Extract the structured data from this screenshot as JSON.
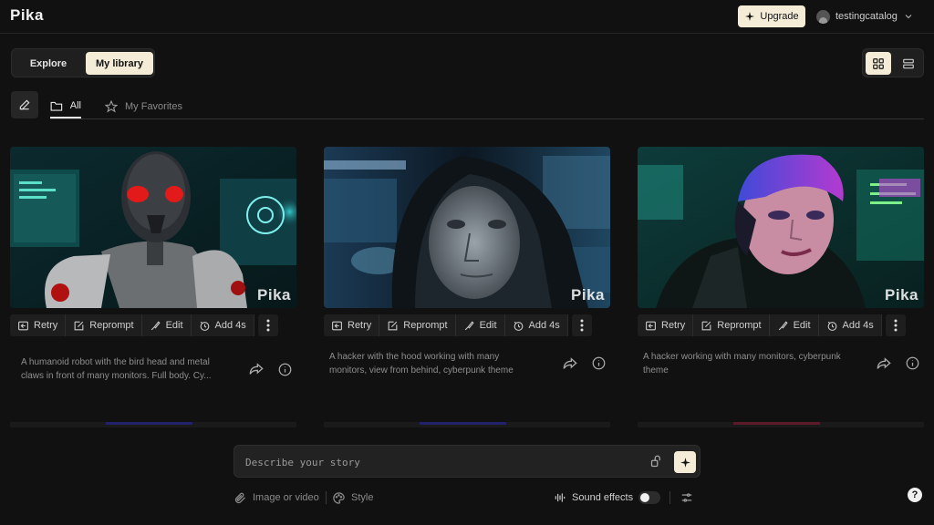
{
  "app": {
    "logo": "Pika"
  },
  "header": {
    "upgrade_label": "Upgrade",
    "username": "testingcatalog"
  },
  "nav": {
    "explore": "Explore",
    "library": "My library"
  },
  "tabs": {
    "all": "All",
    "favorites": "My Favorites"
  },
  "card_actions": {
    "retry": "Retry",
    "reprompt": "Reprompt",
    "edit": "Edit",
    "add": "Add 4s"
  },
  "watermark": "Pika",
  "cards": [
    {
      "description": "A humanoid robot with the bird head and metal claws in front of many monitors. Full body. Cy..."
    },
    {
      "description": "A hacker with the hood working with many monitors, view from behind, cyberpunk theme"
    },
    {
      "description": "A hacker working with many monitors, cyberpunk theme"
    }
  ],
  "prompt": {
    "placeholder": "Describe your story",
    "image_or_video": "Image or video",
    "style": "Style",
    "sound_effects": "Sound effects",
    "sound_effects_on": false
  },
  "help_label": "?",
  "colors": {
    "accent": "#f5ecd7",
    "background": "#111111",
    "surface": "#1e1e1e"
  }
}
